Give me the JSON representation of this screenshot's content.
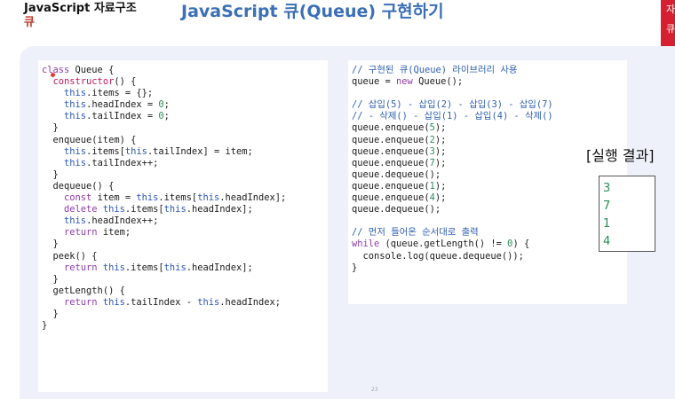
{
  "header": {
    "subtitle_line1": "JavaScript 자료구조",
    "subtitle_line2": "큐",
    "title": "JavaScript 큐(Queue) 구현하기"
  },
  "tag": {
    "line1": "자",
    "line2": "큐"
  },
  "colors": {
    "title": "#3b6fb6",
    "accent": "#d62032",
    "panel_bg": "#eef1f9",
    "result_text": "#2e8b57"
  },
  "code_left": {
    "lines": [
      "class Queue {",
      "  constructor() {",
      "    this.items = {};",
      "    this.headIndex = 0;",
      "    this.tailIndex = 0;",
      "  }",
      "  enqueue(item) {",
      "    this.items[this.tailIndex] = item;",
      "    this.tailIndex++;",
      "  }",
      "  dequeue() {",
      "    const item = this.items[this.headIndex];",
      "    delete this.items[this.headIndex];",
      "    this.headIndex++;",
      "    return item;",
      "  }",
      "  peek() {",
      "    return this.items[this.headIndex];",
      "  }",
      "  getLength() {",
      "    return this.tailIndex - this.headIndex;",
      "  }",
      "}"
    ]
  },
  "code_right": {
    "lines": [
      "// 구현된 큐(Queue) 라이브러리 사용",
      "queue = new Queue();",
      "",
      "// 삽입(5) - 삽입(2) - 삽입(3) - 삽입(7)",
      "// - 삭제() - 삽입(1) - 삽입(4) - 삭제()",
      "queue.enqueue(5);",
      "queue.enqueue(2);",
      "queue.enqueue(3);",
      "queue.enqueue(7);",
      "queue.dequeue();",
      "queue.enqueue(1);",
      "queue.enqueue(4);",
      "queue.dequeue();",
      "",
      "// 먼저 들어온 순서대로 출력",
      "while (queue.getLength() != 0) {",
      "  console.log(queue.dequeue());",
      "}"
    ]
  },
  "result": {
    "label": "[실행 결과]",
    "values": [
      "3",
      "7",
      "1",
      "4"
    ]
  },
  "page_number": "23"
}
